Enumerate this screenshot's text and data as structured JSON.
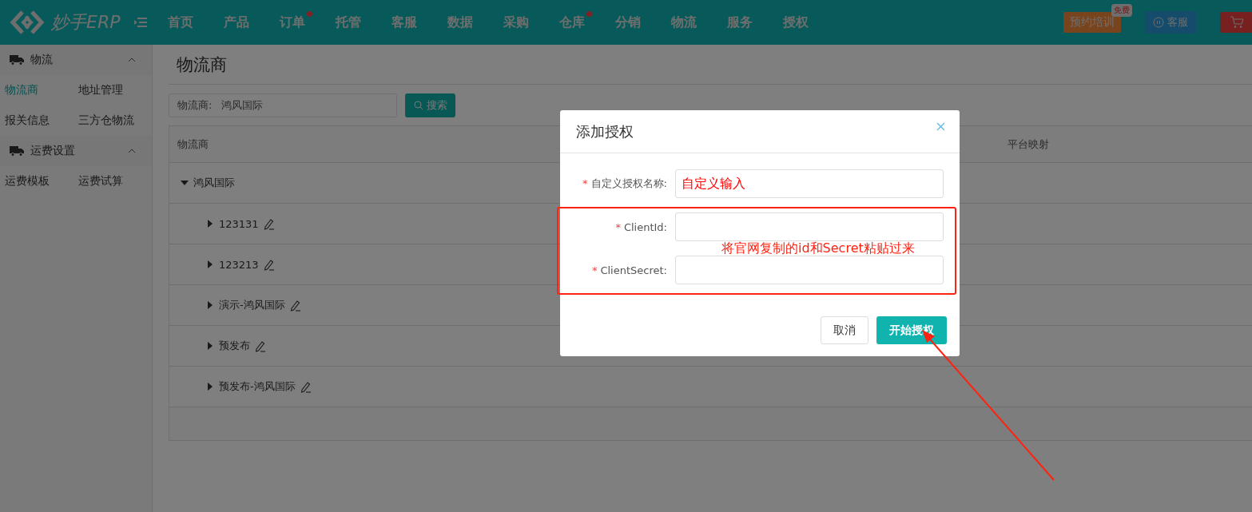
{
  "header": {
    "logo": "妙手ERP",
    "nav": [
      {
        "label": "首页",
        "badge": false
      },
      {
        "label": "产品",
        "badge": false
      },
      {
        "label": "订单",
        "badge": true
      },
      {
        "label": "托管",
        "badge": false
      },
      {
        "label": "客服",
        "badge": false
      },
      {
        "label": "数据",
        "badge": false
      },
      {
        "label": "采购",
        "badge": false
      },
      {
        "label": "仓库",
        "badge": true
      },
      {
        "label": "分销",
        "badge": false
      },
      {
        "label": "物流",
        "badge": false
      },
      {
        "label": "服务",
        "badge": false
      },
      {
        "label": "授权",
        "badge": false
      }
    ],
    "training_button": "预约培训",
    "free_badge": "免费",
    "service_button": "客服"
  },
  "sidebar": {
    "sections": [
      {
        "title": "物流",
        "expanded": true,
        "items": [
          {
            "label": "物流商",
            "selected": true
          },
          {
            "label": "地址管理",
            "selected": false
          },
          {
            "label": "报关信息",
            "selected": false
          },
          {
            "label": "三方仓物流",
            "selected": false
          }
        ]
      },
      {
        "title": "运费设置",
        "expanded": true,
        "items": [
          {
            "label": "运费模板",
            "selected": false
          },
          {
            "label": "运费试算",
            "selected": false
          }
        ]
      }
    ]
  },
  "page": {
    "title": "物流商",
    "search": {
      "label": "物流商:",
      "value": "鸿风国际",
      "button": "搜索"
    },
    "table": {
      "columns": [
        "物流商",
        "平台映射"
      ],
      "rows": [
        {
          "name": "鸿风国际",
          "expanded": true,
          "children": [
            {
              "name": "123131",
              "expanded": false
            },
            {
              "name": "123213",
              "expanded": false
            },
            {
              "name": "演示-鸿风国际",
              "expanded": false
            },
            {
              "name": "预发布",
              "expanded": false
            },
            {
              "name": "预发布-鸿风国际",
              "expanded": false
            }
          ]
        }
      ]
    }
  },
  "dialog": {
    "title": "添加授权",
    "fields": [
      {
        "label": "自定义授权名称:",
        "required_mark": "*",
        "value": "自定义输入"
      },
      {
        "label": "ClientId:",
        "required_mark": "*"
      },
      {
        "label": "ClientSecret:",
        "required_mark": "*"
      }
    ],
    "cancel_button": "取消",
    "confirm_button": "开始授权"
  },
  "annotation": {
    "note": "将官网复制的id和Secret粘贴过来"
  }
}
